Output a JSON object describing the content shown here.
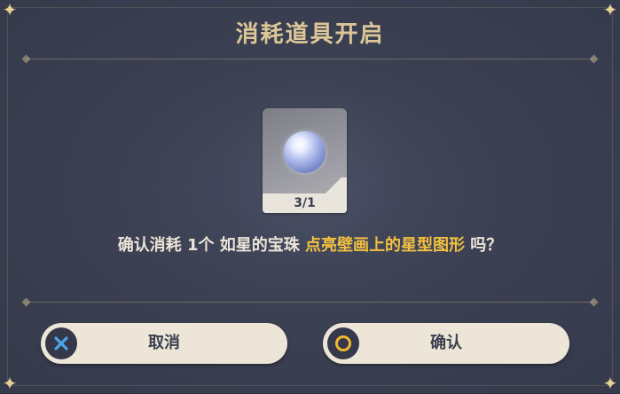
{
  "dialog": {
    "title": "消耗道具开启",
    "item": {
      "icon": "pearl-orb-icon",
      "count": "3/1"
    },
    "message": {
      "prefix": "确认消耗 1个 如星的宝珠 ",
      "highlight": "点亮壁画上的星型图形",
      "suffix": " 吗？"
    },
    "buttons": {
      "cancel_label": "取消",
      "cancel_icon": "close-icon",
      "confirm_label": "确认",
      "confirm_icon": "circle-icon"
    },
    "colors": {
      "title": "#dcc697",
      "highlight": "#f3c040",
      "button_bg": "#ece5d8",
      "cancel_icon": "#4aa8e8",
      "confirm_icon": "#f2b72f"
    }
  }
}
